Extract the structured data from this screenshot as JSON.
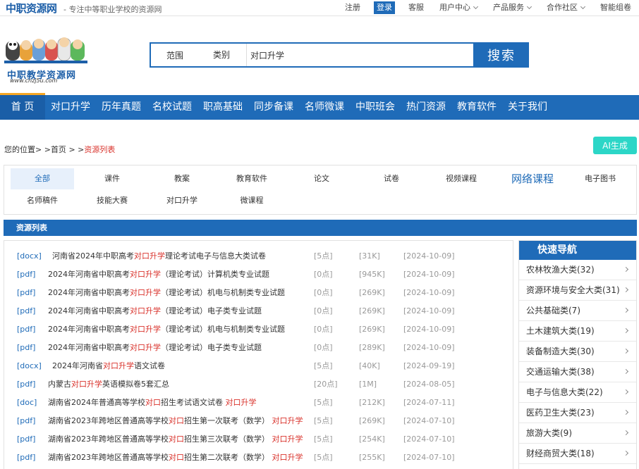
{
  "header": {
    "site_name": "中职资源网",
    "slogan": "- 专注中等职业学校的资源网",
    "top_links": [
      "注册",
      "登录",
      "客服",
      "用户中心",
      "产品服务",
      "合作社区",
      "智能组卷"
    ]
  },
  "logo": {
    "text": "中职教学资源网",
    "url": "www.cnzj5u.com"
  },
  "search": {
    "scope_label": "范围",
    "category_label": "类别",
    "query": "对口升学",
    "button": "搜索"
  },
  "main_nav": [
    "首 页",
    "对口升学",
    "历年真题",
    "名校试题",
    "职高基础",
    "同步备课",
    "名师微课",
    "中职班会",
    "热门资源",
    "教育软件",
    "关于我们"
  ],
  "breadcrumb": {
    "prefix": "您的位置> >",
    "home": "首页",
    "sep": "> >",
    "current": "资源列表"
  },
  "ai_button": "AI生成",
  "categories": {
    "row1": [
      "全部",
      "课件",
      "教案",
      "教育软件",
      "论文",
      "试卷",
      "视频课程",
      "网络课程",
      "电子图书"
    ],
    "row2": [
      "名师稿件",
      "技能大赛",
      "对口升学",
      "微课程"
    ]
  },
  "list_title": "资源列表",
  "resources": [
    {
      "type": "[docx]",
      "pre": "河南省2024年中职高考",
      "kw": "对口升学",
      "post": "理论考试电子与信息大类试卷",
      "kw2": "",
      "points": "[5点]",
      "size": "[31K]",
      "date": "[2024-10-09]"
    },
    {
      "type": "[pdf]",
      "pre": "2024年河南省中职高考",
      "kw": "对口升学",
      "post": "（理论考试）计算机类专业试题",
      "kw2": "",
      "points": "[0点]",
      "size": "[945K]",
      "date": "[2024-10-09]"
    },
    {
      "type": "[pdf]",
      "pre": "2024年河南省中职高考",
      "kw": "对口升学",
      "post": "（理论考试）机电与机制类专业试题",
      "kw2": "",
      "points": "[0点]",
      "size": "[269K]",
      "date": "[2024-10-09]"
    },
    {
      "type": "[pdf]",
      "pre": "2024年河南省中职高考",
      "kw": "对口升学",
      "post": "（理论考试）电子类专业试题",
      "kw2": "",
      "points": "[0点]",
      "size": "[269K]",
      "date": "[2024-10-09]"
    },
    {
      "type": "[pdf]",
      "pre": "2024年河南省中职高考",
      "kw": "对口升学",
      "post": "（理论考试）机电与机制类专业试题",
      "kw2": "",
      "points": "[0点]",
      "size": "[269K]",
      "date": "[2024-10-09]"
    },
    {
      "type": "[pdf]",
      "pre": "2024年河南省中职高考",
      "kw": "对口升学",
      "post": "（理论考试）电子类专业试题",
      "kw2": "",
      "points": "[0点]",
      "size": "[289K]",
      "date": "[2024-10-09]"
    },
    {
      "type": "[docx]",
      "pre": "2024年河南省",
      "kw": "对口升学",
      "post": "语文试卷",
      "kw2": "",
      "points": "[5点]",
      "size": "[40K]",
      "date": "[2024-09-19]"
    },
    {
      "type": "[pdf]",
      "pre": "内蒙古",
      "kw": "对口升学",
      "post": "英语模拟卷5套汇总",
      "kw2": "",
      "points": "[20点]",
      "size": "[1M]",
      "date": "[2024-08-05]"
    },
    {
      "type": "[doc]",
      "pre": "湖南省2024年普通高等学校",
      "kw": "对口",
      "post": "招生考试语文试卷 ",
      "kw2": "对口升学",
      "points": "[5点]",
      "size": "[212K]",
      "date": "[2024-07-11]"
    },
    {
      "type": "[pdf]",
      "pre": "湖南省2023年跨地区普通高等学校",
      "kw": "对口",
      "post": "招生第一次联考（数学） ",
      "kw2": "对口升学",
      "points": "[5点]",
      "size": "[269K]",
      "date": "[2024-07-10]"
    },
    {
      "type": "[pdf]",
      "pre": "湖南省2023年跨地区普通高等学校",
      "kw": "对口",
      "post": "招生第三次联考（数学） ",
      "kw2": "对口升学",
      "points": "[5点]",
      "size": "[254K]",
      "date": "[2024-07-10]"
    },
    {
      "type": "[pdf]",
      "pre": "湖南省2023年跨地区普通高等学校",
      "kw": "对口",
      "post": "招生第二次联考（数学） ",
      "kw2": "对口升学",
      "points": "[5点]",
      "size": "[255K]",
      "date": "[2024-07-10]"
    }
  ],
  "quick_nav": {
    "title": "快速导航",
    "items": [
      "农林牧渔大类(32)",
      "资源环境与安全大类(31)",
      "公共基础类(7)",
      "土木建筑大类(19)",
      "装备制造大类(30)",
      "交通运输大类(38)",
      "电子与信息大类(22)",
      "医药卫生大类(23)",
      "旅游大类(9)",
      "财经商贸大类(18)"
    ]
  },
  "colors": {
    "primary": "#1f6bb8",
    "keyword": "#d9322b",
    "ai_button": "#2cd6c7",
    "accent": "#f5a623"
  }
}
